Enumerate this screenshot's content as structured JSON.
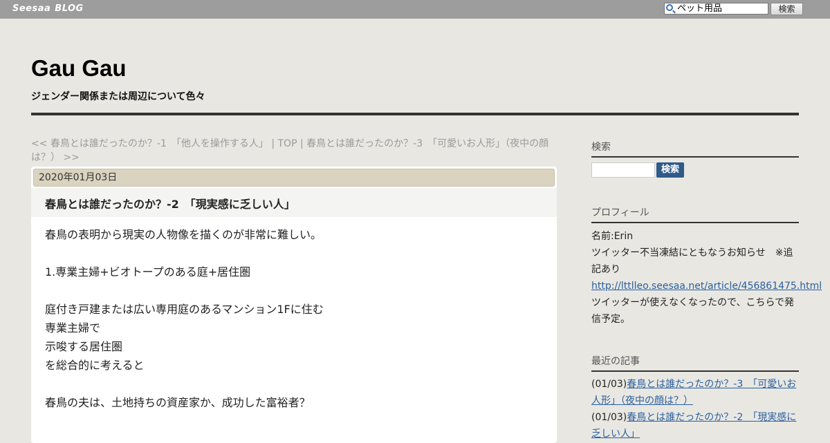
{
  "topbar": {
    "logo_main": "Seesaa",
    "logo_sub": "BLOG",
    "search_value": "ペット用品",
    "search_button": "検索"
  },
  "header": {
    "title": "Gau Gau",
    "description": "ジェンダー関係または周辺について色々"
  },
  "article_nav": {
    "prev": "<< 春鳥とは誰だったのか？-1　「他人を操作する人」",
    "sep1": " | ",
    "top": "TOP",
    "sep2": " | ",
    "next": "春鳥とは誰だったのか？-3　「可愛いお人形」（夜中の顔は？） >>"
  },
  "article": {
    "date": "2020年01月03日",
    "title": "春鳥とは誰だったのか？-2　「現実感に乏しい人」",
    "lines": [
      "春鳥の表明から現実の人物像を描くのが非常に難しい。",
      "",
      "1.専業主婦+ビオトープのある庭+居住圏",
      "",
      "庭付き戸建または広い専用庭のあるマンション1Fに住む",
      "専業主婦で",
      "示唆する居住圏",
      "を総合的に考えると",
      "",
      "春鳥の夫は、土地持ちの資産家か、成功した富裕者？"
    ]
  },
  "sidebar": {
    "search_heading": "検索",
    "search_button": "検索",
    "profile_heading": "プロフィール",
    "profile_name": "名前:Erin",
    "profile_notice": "ツイッター不当凍結にともなうお知らせ　※追記あり",
    "profile_link": "http://lttlleo.seesaa.net/article/456861475.html",
    "profile_note": "ツイッターが使えなくなったので、こちらで発信予定。",
    "recent_heading": "最近の記事",
    "recent": [
      {
        "date": "(01/03)",
        "title": "春鳥とは誰だったのか？-3　「可愛いお人形」（夜中の顔は？）"
      },
      {
        "date": "(01/03)",
        "title": "春鳥とは誰だったのか？-2　「現実感に乏しい人」"
      }
    ]
  }
}
